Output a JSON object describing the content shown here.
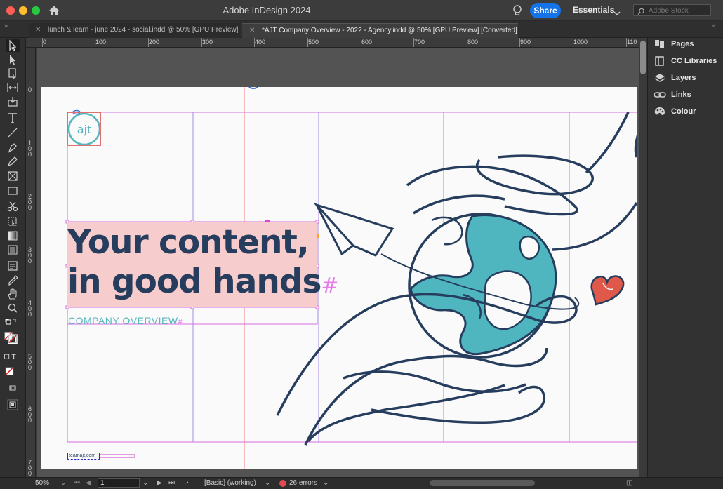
{
  "window": {
    "title": "Adobe InDesign 2024",
    "share_label": "Share",
    "workspace_label": "Essentials",
    "stock_search_placeholder": "Adobe Stock"
  },
  "tabs": [
    {
      "label": "lunch & learn - june 2024 - social.indd @ 50% [GPU Preview]",
      "active": false
    },
    {
      "label": "*AJT Company Overview - 2022 - Agency.indd @ 50% [GPU Preview] [Converted]",
      "active": true
    }
  ],
  "ruler": {
    "horizontal": [
      "0",
      "100",
      "200",
      "300",
      "400",
      "500",
      "600",
      "700",
      "800",
      "900",
      "1000",
      "110"
    ],
    "vertical": [
      "0",
      "1\n0\n0",
      "2\n0\n0",
      "3\n0\n0",
      "4\n0\n0",
      "5\n0\n0",
      "6\n0\n0",
      "7\n0\n0"
    ]
  },
  "panel": {
    "items": [
      {
        "label": "Pages",
        "icon": "pages-icon"
      },
      {
        "label": "CC Libraries",
        "icon": "cc-libraries-icon"
      },
      {
        "label": "Layers",
        "icon": "layers-icon"
      },
      {
        "label": "Links",
        "icon": "links-icon"
      },
      {
        "label": "Colour",
        "icon": "colour-icon"
      }
    ]
  },
  "document": {
    "logo_text": "ajt",
    "headline_line1": "Your content,",
    "headline_line2": "in good hands",
    "overflow_mark": "#",
    "subtitle": "COMPANY OVERVIEW",
    "subtitle_mark": "#",
    "footer_url": "teamajt.com",
    "colors": {
      "navy": "#263d5e",
      "teal": "#58b6c0",
      "highlight": "#f7cccc",
      "heart": "#e0584a",
      "frame_guide": "#d86ee0"
    }
  },
  "status": {
    "zoom": "50%",
    "page": "1",
    "style": "[Basic] (working)",
    "errors": "26 errors"
  }
}
